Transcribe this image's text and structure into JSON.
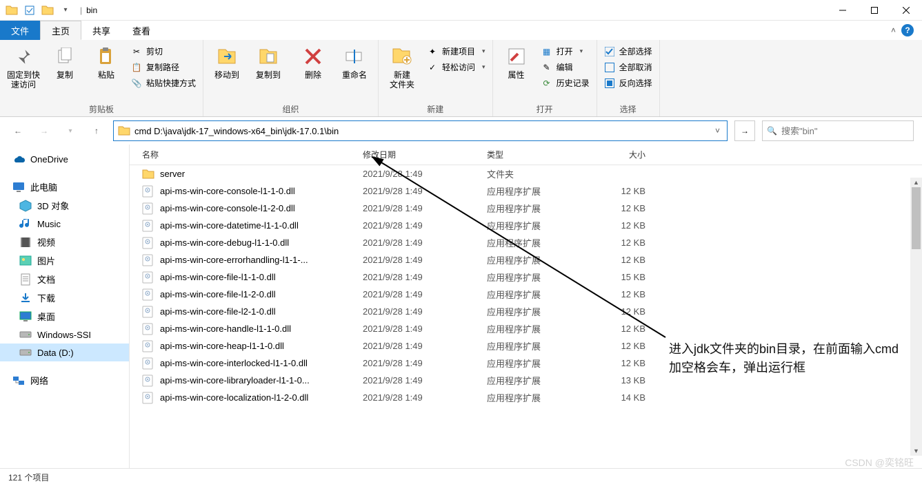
{
  "title": {
    "folder": "bin"
  },
  "tabs": {
    "file": "文件",
    "home": "主页",
    "share": "共享",
    "view": "查看"
  },
  "ribbon": {
    "clipboard": {
      "pin": "固定到快\n速访问",
      "copy": "复制",
      "paste": "粘贴",
      "cut": "剪切",
      "copy_path": "复制路径",
      "paste_shortcut": "粘贴快捷方式",
      "label": "剪贴板"
    },
    "organize": {
      "move_to": "移动到",
      "copy_to": "复制到",
      "delete": "删除",
      "rename": "重命名",
      "label": "组织"
    },
    "new": {
      "new_folder": "新建\n文件夹",
      "new_item": "新建项目",
      "easy_access": "轻松访问",
      "label": "新建"
    },
    "open": {
      "properties": "属性",
      "open": "打开",
      "edit": "编辑",
      "history": "历史记录",
      "label": "打开"
    },
    "select": {
      "select_all": "全部选择",
      "select_none": "全部取消",
      "invert": "反向选择",
      "label": "选择"
    }
  },
  "address": {
    "text": "cmd D:\\java\\jdk-17_windows-x64_bin\\jdk-17.0.1\\bin"
  },
  "search": {
    "placeholder": "搜索\"bin\""
  },
  "sidebar": {
    "onedrive": "OneDrive",
    "thispc": "此电脑",
    "items": [
      {
        "label": "3D 对象",
        "icon": "cube"
      },
      {
        "label": "Music",
        "icon": "music"
      },
      {
        "label": "视频",
        "icon": "film"
      },
      {
        "label": "图片",
        "icon": "picture"
      },
      {
        "label": "文档",
        "icon": "doc"
      },
      {
        "label": "下载",
        "icon": "download"
      },
      {
        "label": "桌面",
        "icon": "desktop"
      },
      {
        "label": "Windows-SSI",
        "icon": "drive"
      },
      {
        "label": "Data (D:)",
        "icon": "drive",
        "selected": true
      }
    ],
    "network": "网络"
  },
  "columns": {
    "name": "名称",
    "date": "修改日期",
    "type": "类型",
    "size": "大小"
  },
  "files": [
    {
      "name": "server",
      "date": "2021/9/28 1:49",
      "type": "文件夹",
      "size": "",
      "kind": "folder"
    },
    {
      "name": "api-ms-win-core-console-l1-1-0.dll",
      "date": "2021/9/28 1:49",
      "type": "应用程序扩展",
      "size": "12 KB",
      "kind": "dll"
    },
    {
      "name": "api-ms-win-core-console-l1-2-0.dll",
      "date": "2021/9/28 1:49",
      "type": "应用程序扩展",
      "size": "12 KB",
      "kind": "dll"
    },
    {
      "name": "api-ms-win-core-datetime-l1-1-0.dll",
      "date": "2021/9/28 1:49",
      "type": "应用程序扩展",
      "size": "12 KB",
      "kind": "dll"
    },
    {
      "name": "api-ms-win-core-debug-l1-1-0.dll",
      "date": "2021/9/28 1:49",
      "type": "应用程序扩展",
      "size": "12 KB",
      "kind": "dll"
    },
    {
      "name": "api-ms-win-core-errorhandling-l1-1-...",
      "date": "2021/9/28 1:49",
      "type": "应用程序扩展",
      "size": "12 KB",
      "kind": "dll"
    },
    {
      "name": "api-ms-win-core-file-l1-1-0.dll",
      "date": "2021/9/28 1:49",
      "type": "应用程序扩展",
      "size": "15 KB",
      "kind": "dll"
    },
    {
      "name": "api-ms-win-core-file-l1-2-0.dll",
      "date": "2021/9/28 1:49",
      "type": "应用程序扩展",
      "size": "12 KB",
      "kind": "dll"
    },
    {
      "name": "api-ms-win-core-file-l2-1-0.dll",
      "date": "2021/9/28 1:49",
      "type": "应用程序扩展",
      "size": "12 KB",
      "kind": "dll"
    },
    {
      "name": "api-ms-win-core-handle-l1-1-0.dll",
      "date": "2021/9/28 1:49",
      "type": "应用程序扩展",
      "size": "12 KB",
      "kind": "dll"
    },
    {
      "name": "api-ms-win-core-heap-l1-1-0.dll",
      "date": "2021/9/28 1:49",
      "type": "应用程序扩展",
      "size": "12 KB",
      "kind": "dll"
    },
    {
      "name": "api-ms-win-core-interlocked-l1-1-0.dll",
      "date": "2021/9/28 1:49",
      "type": "应用程序扩展",
      "size": "12 KB",
      "kind": "dll"
    },
    {
      "name": "api-ms-win-core-libraryloader-l1-1-0...",
      "date": "2021/9/28 1:49",
      "type": "应用程序扩展",
      "size": "13 KB",
      "kind": "dll"
    },
    {
      "name": "api-ms-win-core-localization-l1-2-0.dll",
      "date": "2021/9/28 1:49",
      "type": "应用程序扩展",
      "size": "14 KB",
      "kind": "dll"
    }
  ],
  "status": {
    "items": "121 个项目"
  },
  "annotation": "进入jdk文件夹的bin目录，在前面输入cmd加空格会车，弹出运行框",
  "watermark": "CSDN @奕铭旺"
}
